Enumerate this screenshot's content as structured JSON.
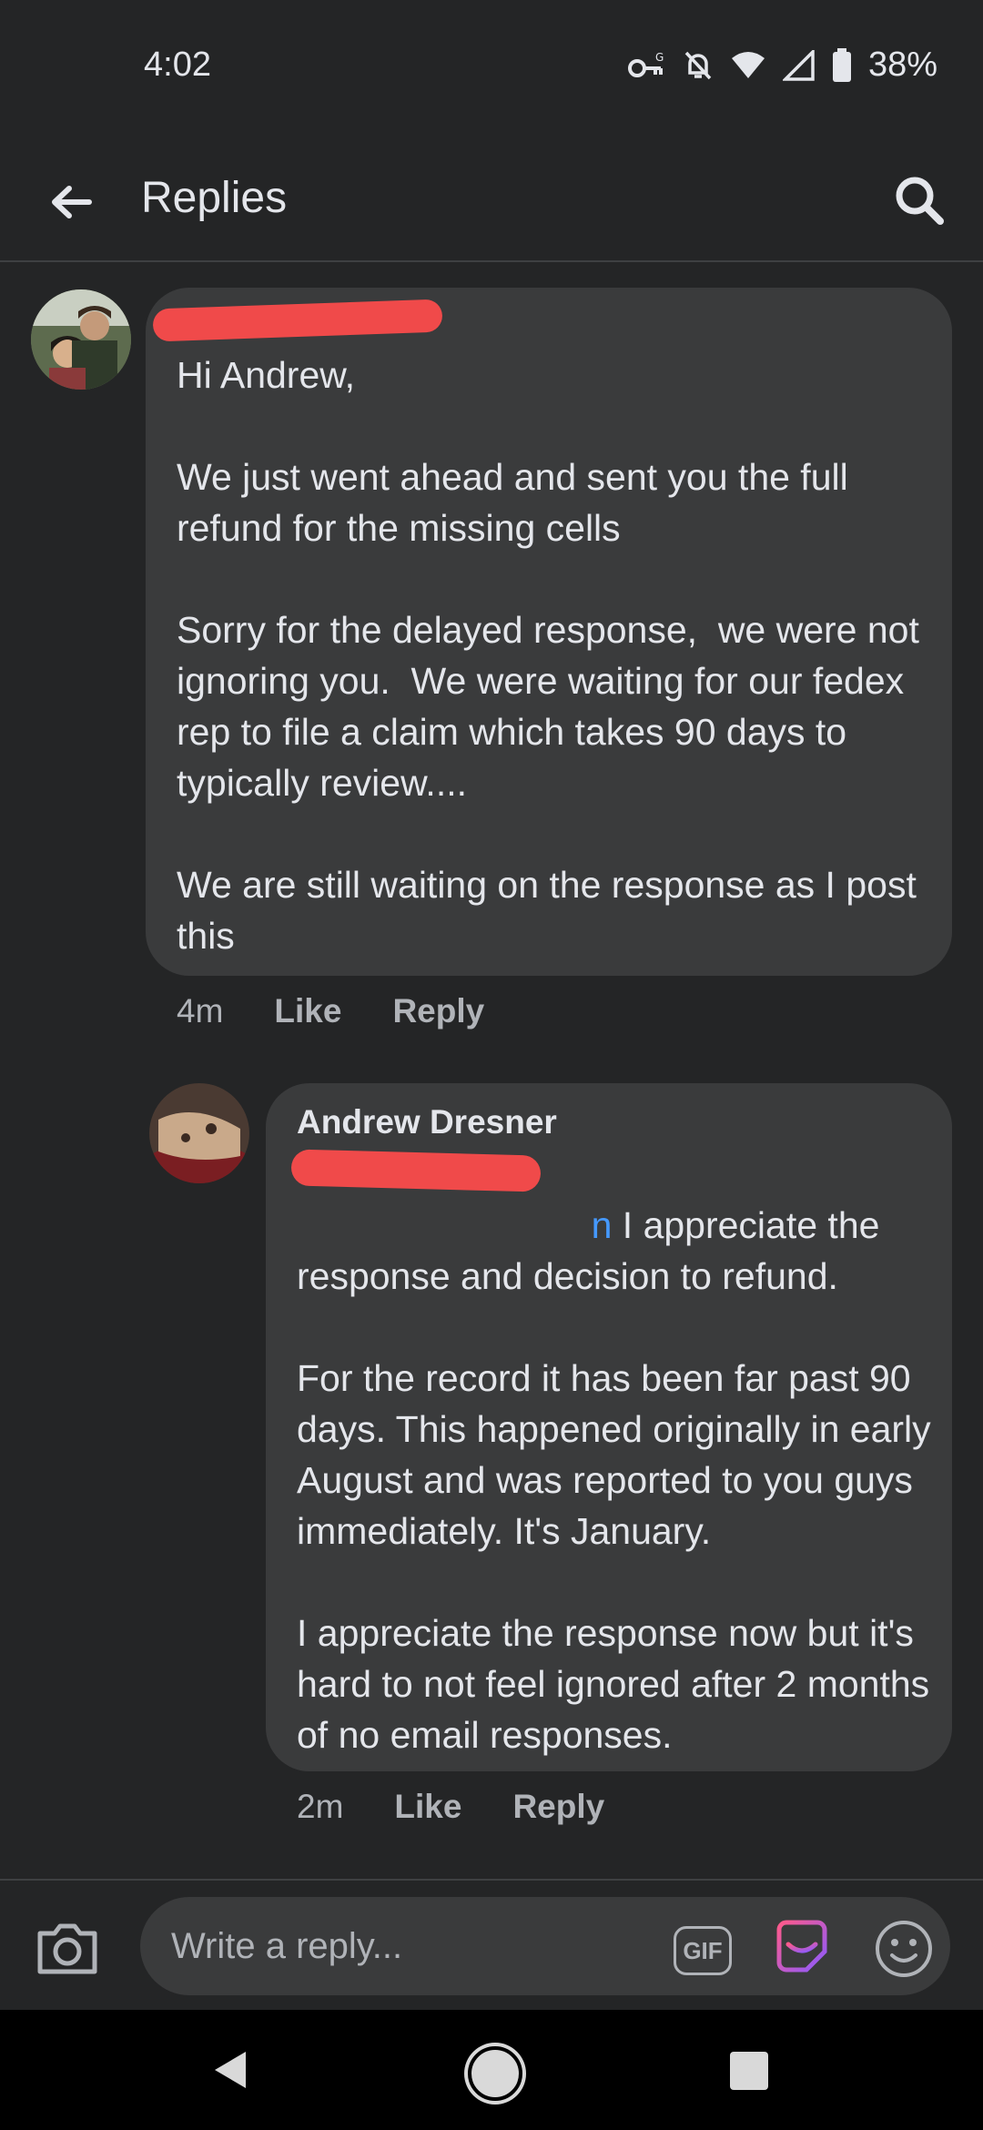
{
  "status_bar": {
    "time": "4:02",
    "battery": "38%",
    "icons": [
      "vpn-key-icon",
      "notifications-off-icon",
      "wifi-icon",
      "signal-icon",
      "battery-icon"
    ]
  },
  "app_bar": {
    "title": "Replies",
    "back_icon": "arrow-left-icon",
    "search_icon": "search-icon"
  },
  "comments": [
    {
      "author": "",
      "author_redacted": true,
      "text": "Hi Andrew,\n\nWe just went ahead and sent you the full refund for the missing cells\n\nSorry for the delayed response,  we were not ignoring you.  We were waiting for our fedex rep to file a claim which takes 90 days to typically review....\n\nWe are still waiting on the response as I post this",
      "time": "4m",
      "like_label": "Like",
      "reply_label": "Reply"
    },
    {
      "author": "Andrew Dresner",
      "mention": "n",
      "mention_redacted": true,
      "text": " I appreciate the response and decision to refund.\n\nFor the record it has been far past 90 days. This happened originally in early August and was reported to you guys immediately. It's January.\n\nI appreciate the response now but it's hard to not feel ignored after 2 months of no email responses.",
      "time": "2m",
      "like_label": "Like",
      "reply_label": "Reply"
    }
  ],
  "composer": {
    "placeholder": "Write a reply...",
    "gif_label": "GIF",
    "camera_icon": "camera-icon",
    "sticker_icon": "sticker-icon",
    "emoji_icon": "emoji-icon"
  },
  "colors": {
    "background": "#242526",
    "bubble": "#3a3b3c",
    "mention": "#4599ff",
    "redaction": "#f04a4a",
    "secondary_text": "#b0b3b8"
  }
}
